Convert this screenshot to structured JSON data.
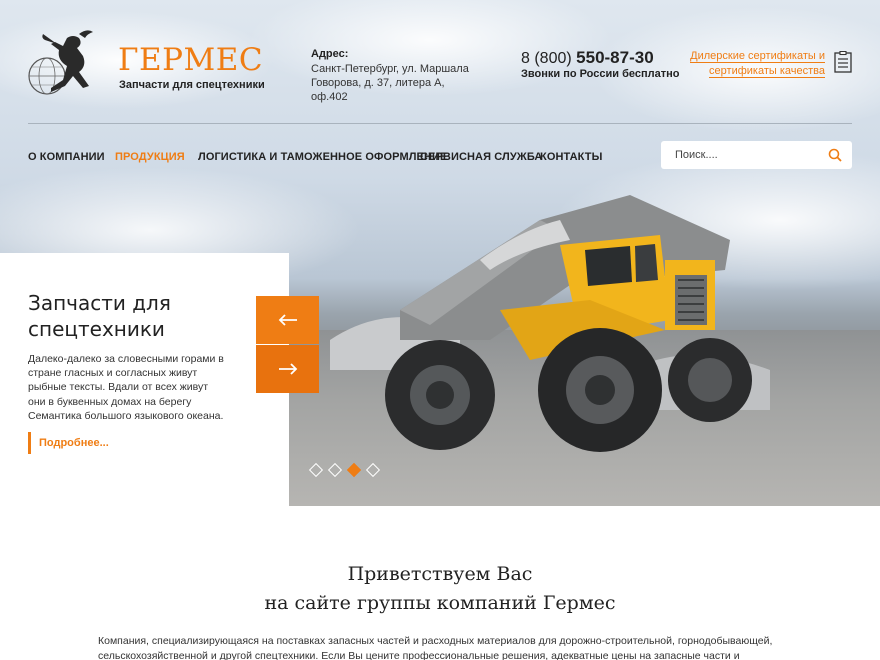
{
  "brand": {
    "name": "ГЕРМЕС",
    "subtitle": "Запчасти для спецтехники"
  },
  "contacts": {
    "address_label": "Адрес:",
    "address": "Санкт-Петербург, ул. Маршала Говорова, д. 37, литера А, оф.402",
    "phone_prefix": "8 (800)",
    "phone_number": "550-87-30",
    "phone_note": "Звонки по России бесплатно"
  },
  "certificates": {
    "line1": "Дилерские сертификаты и",
    "line2": "сертификаты качества",
    "icon": "document-list-icon"
  },
  "nav": {
    "items": [
      {
        "label": "О КОМПАНИИ",
        "active": false
      },
      {
        "label": "ПРОДУКЦИЯ",
        "active": true
      },
      {
        "label": "ЛОГИСТИКА И ТАМОЖЕННОЕ ОФОРМЛЕНИЕ",
        "active": false
      },
      {
        "label": "СЕРВИСНАЯ СЛУЖБА",
        "active": false
      },
      {
        "label": "КОНТАКТЫ",
        "active": false
      }
    ],
    "search_placeholder": "Поиск...."
  },
  "slider": {
    "title": "Запчасти для спецтехники",
    "text": "Далеко-далеко за словесными горами в стране гласных и согласных живут рыбные тексты. Вдали от всех живут они в буквенных домах на берегу Семантика большого языкового океана.",
    "more_label": "Подробнее...",
    "slide_count": 4,
    "active_slide": 3
  },
  "welcome": {
    "title_line1": "Приветствуем Вас",
    "title_line2": "на сайте группы компаний Гермес",
    "text": "Компания, специализирующаяся на поставках запасных частей и расходных материалов для дорожно-строительной, горнодобывающей, сельскохозяйственной и другой спецтехники.  Если Вы цените профессиональные решения, адекватные цены на запасные части и безупречный"
  },
  "colors": {
    "accent": "#ef7d14",
    "text": "#222222"
  }
}
